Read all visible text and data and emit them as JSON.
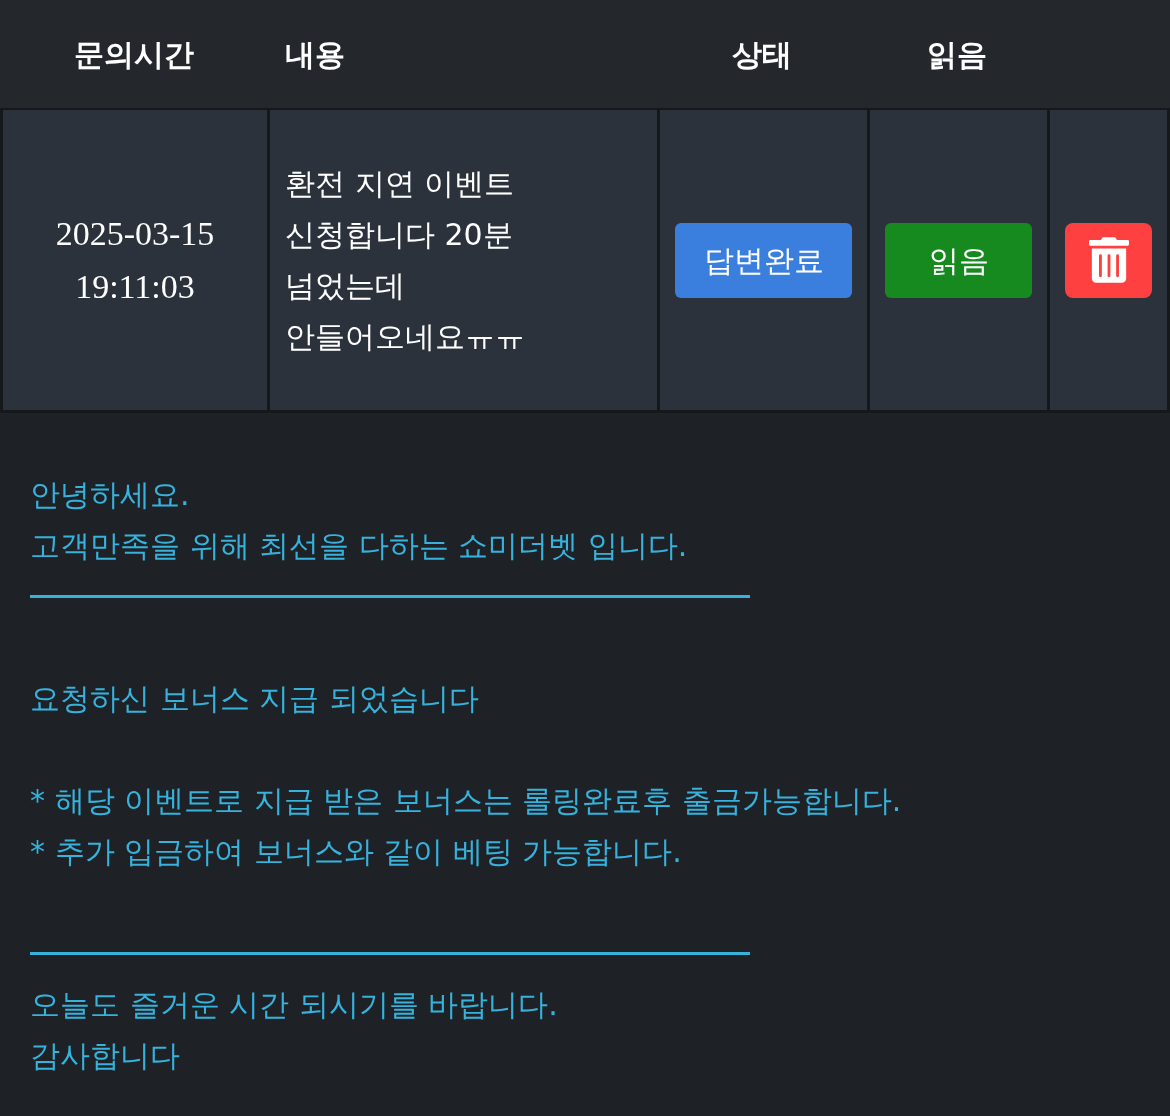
{
  "table": {
    "columns": [
      "문의시간",
      "내용",
      "상태",
      "읽음"
    ],
    "rows": [
      {
        "inquiry_time": "2025-03-15 19:11:03",
        "content": "환전 지연 이벤트 신청합니다 20분 넘었는데 안들어오네요ㅠㅠ",
        "status": {
          "label": "답변완료",
          "kind": "answered"
        },
        "read": {
          "label": "읽음",
          "kind": "read"
        }
      }
    ]
  },
  "answer": {
    "blocks": [
      {
        "kind": "text",
        "text": "안녕하세요."
      },
      {
        "kind": "text",
        "text": "고객만족을 위해 최선을 다하는 쇼미더벳 입니다."
      },
      {
        "kind": "rule"
      },
      {
        "kind": "blank"
      },
      {
        "kind": "text",
        "text": "요청하신 보너스 지급 되었습니다"
      },
      {
        "kind": "blank"
      },
      {
        "kind": "text",
        "text": "* 해당 이벤트로 지급 받은 보너스는 롤링완료후 출금가능합니다."
      },
      {
        "kind": "text",
        "text": "* 추가 입금하여 보너스와 같이 베팅 가능합니다."
      },
      {
        "kind": "blank"
      },
      {
        "kind": "rule"
      },
      {
        "kind": "text",
        "text": "오늘도 즐거운 시간 되시기를 바랍니다."
      },
      {
        "kind": "text",
        "text": "감사합니다"
      }
    ]
  }
}
